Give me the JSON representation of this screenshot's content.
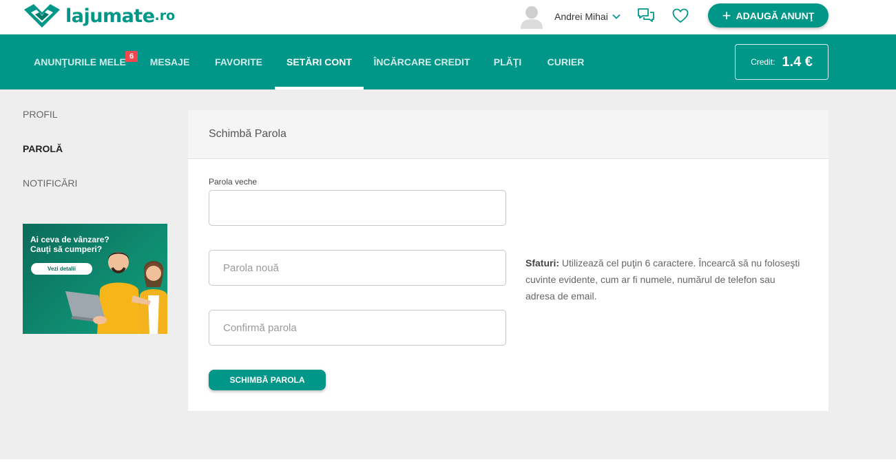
{
  "header": {
    "logo_text": "lajumate",
    "logo_tld": ".ro",
    "user_name": "Andrei Mihai",
    "add_button_label": "ADAUGĂ ANUNŢ",
    "icons": [
      "logo-handshake-icon",
      "avatar-icon",
      "chevron-down-icon",
      "chat-bubbles-icon",
      "heart-icon",
      "plus-icon"
    ]
  },
  "nav": {
    "tabs": [
      {
        "label": "ANUNŢURILE MELE",
        "badge": "6"
      },
      {
        "label": "MESAJE"
      },
      {
        "label": "FAVORITE"
      },
      {
        "label": "SETĂRI CONT",
        "active": true
      },
      {
        "label": "ÎNCĂRCARE CREDIT"
      },
      {
        "label": "PLĂŢI"
      },
      {
        "label": "CURIER"
      }
    ],
    "credit_label": "Credit:",
    "credit_value": "1.4 €"
  },
  "sidebar": {
    "items": [
      {
        "label": "PROFIL"
      },
      {
        "label": "PAROLĂ",
        "active": true
      },
      {
        "label": "NOTIFICĂRI"
      }
    ]
  },
  "promo": {
    "line1": "Ai ceva de vânzare?",
    "line2": "Cauți să cumperi?",
    "button_label": "Vezi detalii"
  },
  "form": {
    "title": "Schimbă Parola",
    "old_password_label": "Parola veche",
    "old_password_value": "",
    "new_password_placeholder": "Parola nouă",
    "confirm_password_placeholder": "Confirmă parola",
    "tips_label": "Sfaturi:",
    "tips_text": "Utilizează cel puţin 6 caractere. Încearcă să nu foloseşti cuvinte evidente, cum ar fi numele, numărul de telefon sau adresa de email.",
    "submit_label": "SCHIMBĂ PAROLA"
  },
  "colors": {
    "accent": "#009688",
    "badge": "#f5474f",
    "content_bg": "#eeeeee"
  }
}
